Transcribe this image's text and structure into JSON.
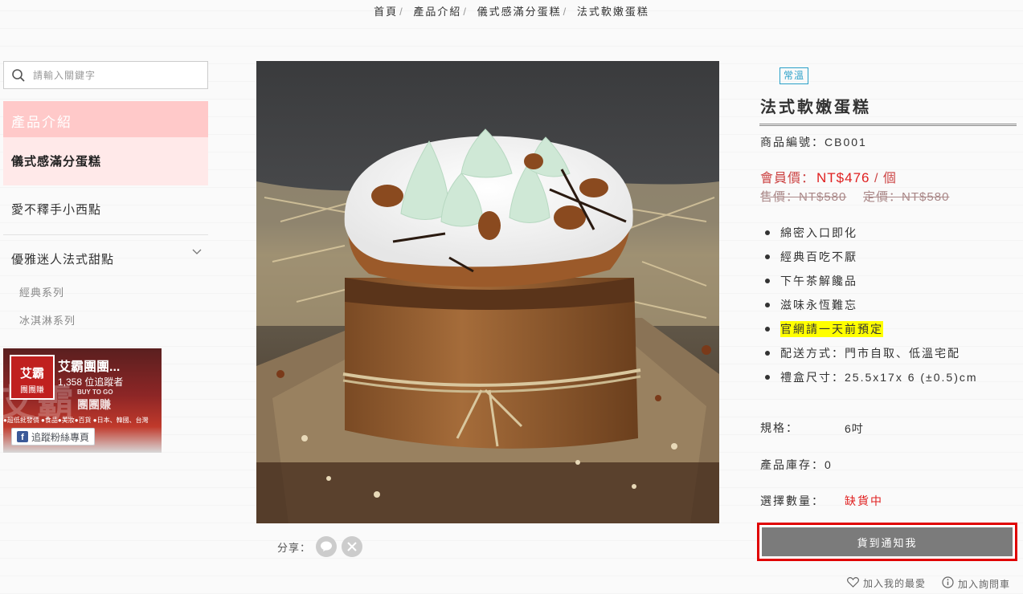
{
  "breadcrumb": [
    "首頁",
    "產品介紹",
    "儀式感滿分蛋糕",
    "法式軟嫩蛋糕"
  ],
  "sidebar": {
    "search_placeholder": "請輸入關鍵字",
    "header": "產品介紹",
    "active_item": "儀式感滿分蛋糕",
    "items": [
      "愛不釋手小西點",
      "優雅迷人法式甜點"
    ],
    "sub_items": [
      "經典系列",
      "冰淇淋系列"
    ]
  },
  "fb_widget": {
    "logo_line1": "艾霸",
    "logo_line2": "團團賺",
    "page_name": "艾霸團團...",
    "followers": "1,358 位追蹤者",
    "bg_text": "艾霸",
    "tagline1": "BUY TO GO",
    "tagline2": "團團賺",
    "strip": "●超低批發價 ●食品●美妝●百貨 ●日本、韓國、台灣",
    "follow_label": "追蹤粉絲專頁"
  },
  "product": {
    "badge": "常溫",
    "title": "法式軟嫩蛋糕",
    "sku": "商品編號：CB001",
    "member_label": "會員價：",
    "member_price": "NT$476",
    "member_unit": " / 個",
    "sale_label": "售價：NT$580",
    "list_label": "定價：NT$580",
    "features": [
      "綿密入口即化",
      "經典百吃不厭",
      "下午茶解饞品",
      "滋味永恆難忘",
      "官網請一天前預定",
      "配送方式：門市自取、低溫宅配",
      "禮盒尺寸：25.5x17x 6 (±0.5)cm"
    ],
    "spec_label": "規格：",
    "spec_value": "6吋",
    "stock_label": "產品庫存：0",
    "qty_label": "選擇數量：",
    "qty_status": "缺貨中",
    "notify_button": "貨到通知我",
    "fav_label": "加入我的最愛",
    "inquiry_label": "加入詢問車",
    "share_label": "分享："
  },
  "icons": {
    "search": "search-icon",
    "chevron": "chevron-down-icon",
    "line": "line-share-icon",
    "x": "x-share-icon",
    "heart": "heart-icon",
    "info": "info-icon",
    "facebook": "facebook-icon"
  },
  "colors": {
    "accent_pink": "#ffc9c9",
    "active_pink": "#ffe9e9",
    "price_red": "#e02020",
    "badge_blue": "#2aa0c8",
    "notify_border": "#e00000"
  }
}
